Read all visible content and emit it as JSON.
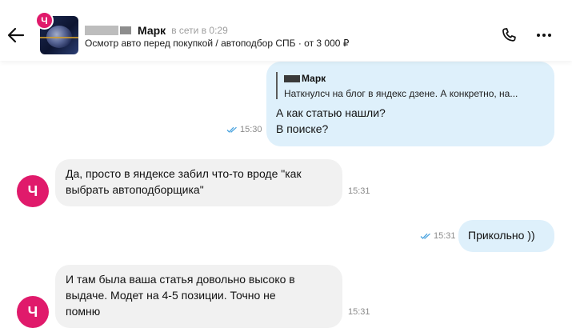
{
  "header": {
    "avatar_letter": "Ч",
    "contact_name": "Марк",
    "status": "в сети в 0:29",
    "subtitle": "Осмотр авто перед покупкой / автоподбор СПБ · от 3 000 ₽",
    "icons": [
      "back-arrow-icon",
      "phone-icon",
      "more-icon"
    ]
  },
  "messages": [
    {
      "direction": "out",
      "quote": {
        "author": "Марк",
        "text": "Наткнулсч на блог в яндекс дзене. А конкретно, на..."
      },
      "lines": [
        "А как статью нашли?",
        "В поиске?"
      ],
      "time": "15:30",
      "read": true
    },
    {
      "direction": "in",
      "avatar_letter": "Ч",
      "lines": [
        "Да, просто в яндексе забил что-то вроде \"как",
        "выбрать автоподборщика\""
      ],
      "time": "15:31"
    },
    {
      "direction": "out",
      "lines": [
        "Прикольно ))"
      ],
      "time": "15:31",
      "read": true
    },
    {
      "direction": "in",
      "avatar_letter": "Ч",
      "lines": [
        "И там была ваша статья довольно высоко в",
        "выдаче. Модет на 4-5 позиции. Точно не",
        "помню"
      ],
      "time": "15:31"
    }
  ],
  "colors": {
    "accent": "#e01a6b",
    "outgoing_bubble": "#def0fb",
    "incoming_bubble": "#f1f1f1",
    "read_ticks": "#4aa3df"
  }
}
